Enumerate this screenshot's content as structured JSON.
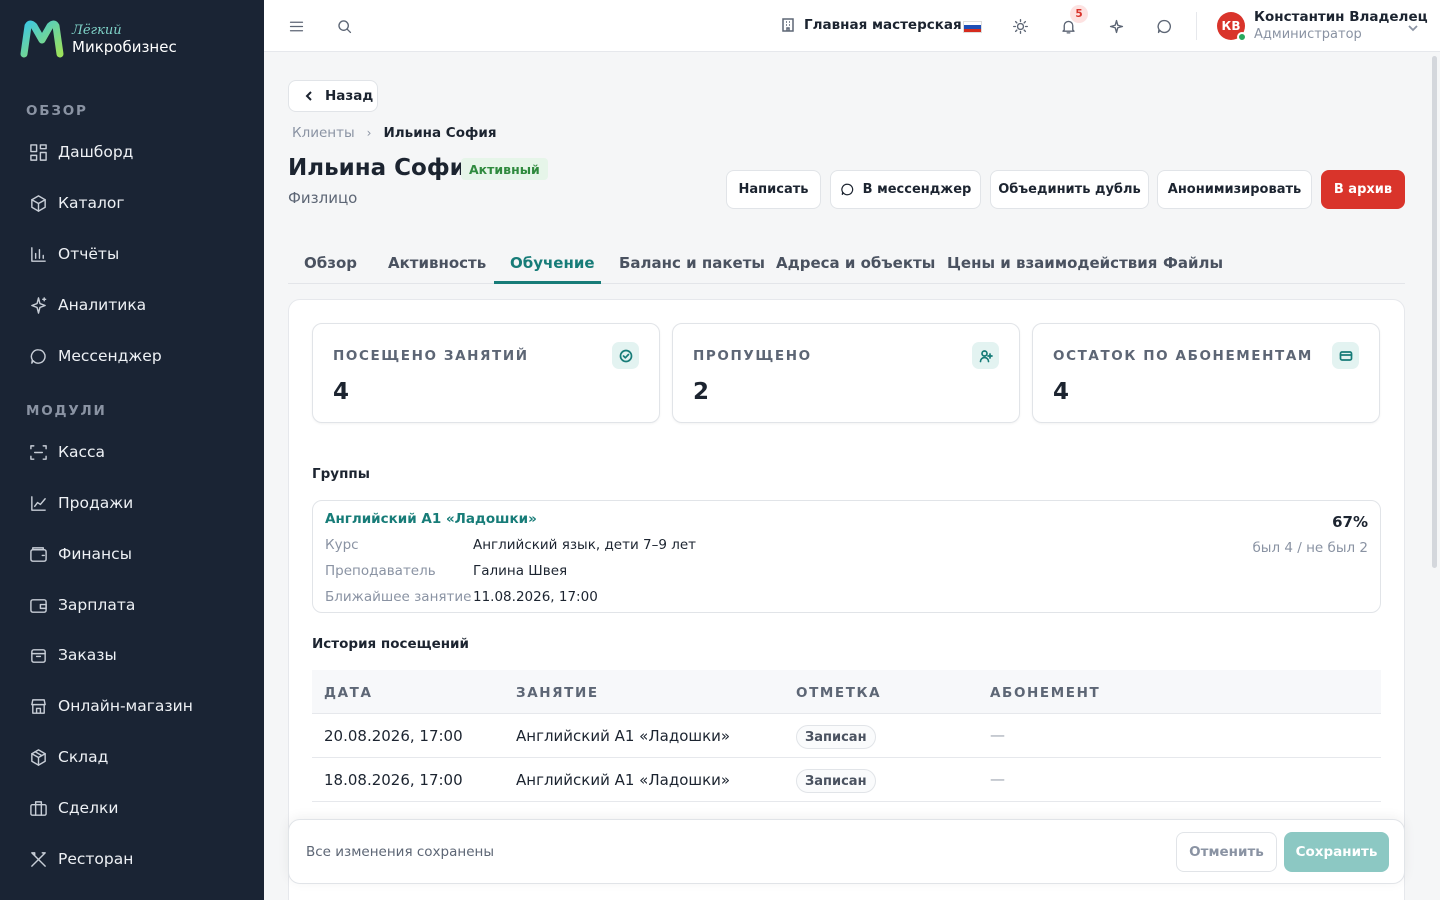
{
  "brand": {
    "line1": "Лёгкий",
    "line2": "Микробизнес"
  },
  "sidebar": {
    "section_overview": "ОБЗОР",
    "section_modules": "МОДУЛИ",
    "overview_items": [
      {
        "label": "Дашборд",
        "icon": "dashboard-icon"
      },
      {
        "label": "Каталог",
        "icon": "catalog-icon"
      },
      {
        "label": "Отчёты",
        "icon": "reports-icon"
      },
      {
        "label": "Аналитика",
        "icon": "analytics-icon"
      },
      {
        "label": "Мессенджер",
        "icon": "messenger-icon"
      }
    ],
    "module_items": [
      {
        "label": "Касса",
        "icon": "cash-register-icon"
      },
      {
        "label": "Продажи",
        "icon": "sales-icon"
      },
      {
        "label": "Финансы",
        "icon": "finance-icon"
      },
      {
        "label": "Зарплата",
        "icon": "salary-icon"
      },
      {
        "label": "Заказы",
        "icon": "orders-icon"
      },
      {
        "label": "Онлайн-магазин",
        "icon": "shop-icon"
      },
      {
        "label": "Склад",
        "icon": "warehouse-icon"
      },
      {
        "label": "Сделки",
        "icon": "deals-icon"
      },
      {
        "label": "Ресторан",
        "icon": "restaurant-icon"
      }
    ]
  },
  "topbar": {
    "workshop": "Главная мастерская",
    "notifications_count": "5",
    "user_initials": "КВ",
    "user_name": "Константин Владелец",
    "user_role": "Администратор"
  },
  "page": {
    "back_label": "Назад",
    "breadcrumb": [
      "Клиенты",
      "Ильина София"
    ],
    "title": "Ильина София",
    "status": "Активный",
    "subtitle": "Физлицо",
    "actions": {
      "write": "Написать",
      "messenger": "В мессенджер",
      "merge": "Объединить дубль",
      "anonymize": "Анонимизировать",
      "archive": "В архив"
    },
    "tabs": [
      "Обзор",
      "Активность",
      "Обучение",
      "Баланс и пакеты",
      "Адреса и объекты",
      "Цены и взаимодействия",
      "Файлы"
    ],
    "active_tab": "Обучение"
  },
  "stats": [
    {
      "label": "ПОСЕЩЕНО ЗАНЯТИЙ",
      "value": "4",
      "icon": "check-circle-icon"
    },
    {
      "label": "ПРОПУЩЕНО",
      "value": "2",
      "icon": "user-plus-icon"
    },
    {
      "label": "ОСТАТОК ПО АБОНЕМЕНТАМ",
      "value": "4",
      "icon": "card-icon"
    }
  ],
  "groups": {
    "heading": "Группы",
    "name": "Английский А1 «Ладошки»",
    "course_label": "Курс",
    "course": "Английский язык, дети 7–9 лет",
    "teacher_label": "Преподаватель",
    "teacher": "Галина Швея",
    "next_label": "Ближайшее занятие",
    "next": "11.08.2026, 17:00",
    "percent": "67%",
    "attendance": "был 4 / не был 2"
  },
  "history": {
    "heading": "История посещений",
    "columns": [
      "ДАТА",
      "ЗАНЯТИЕ",
      "ОТМЕТКА",
      "АБОНЕМЕНТ"
    ],
    "rows": [
      {
        "date": "20.08.2026, 17:00",
        "lesson": "Английский А1 «Ладошки»",
        "mark": "Записан",
        "subscription": "—"
      },
      {
        "date": "18.08.2026, 17:00",
        "lesson": "Английский А1 «Ладошки»",
        "mark": "Записан",
        "subscription": "—"
      }
    ]
  },
  "footer": {
    "message": "Все изменения сохранены",
    "cancel": "Отменить",
    "save": "Сохранить"
  },
  "colors": {
    "accent": "#177c78",
    "danger": "#d9342b",
    "sidebar_bg": "#1a2434"
  }
}
